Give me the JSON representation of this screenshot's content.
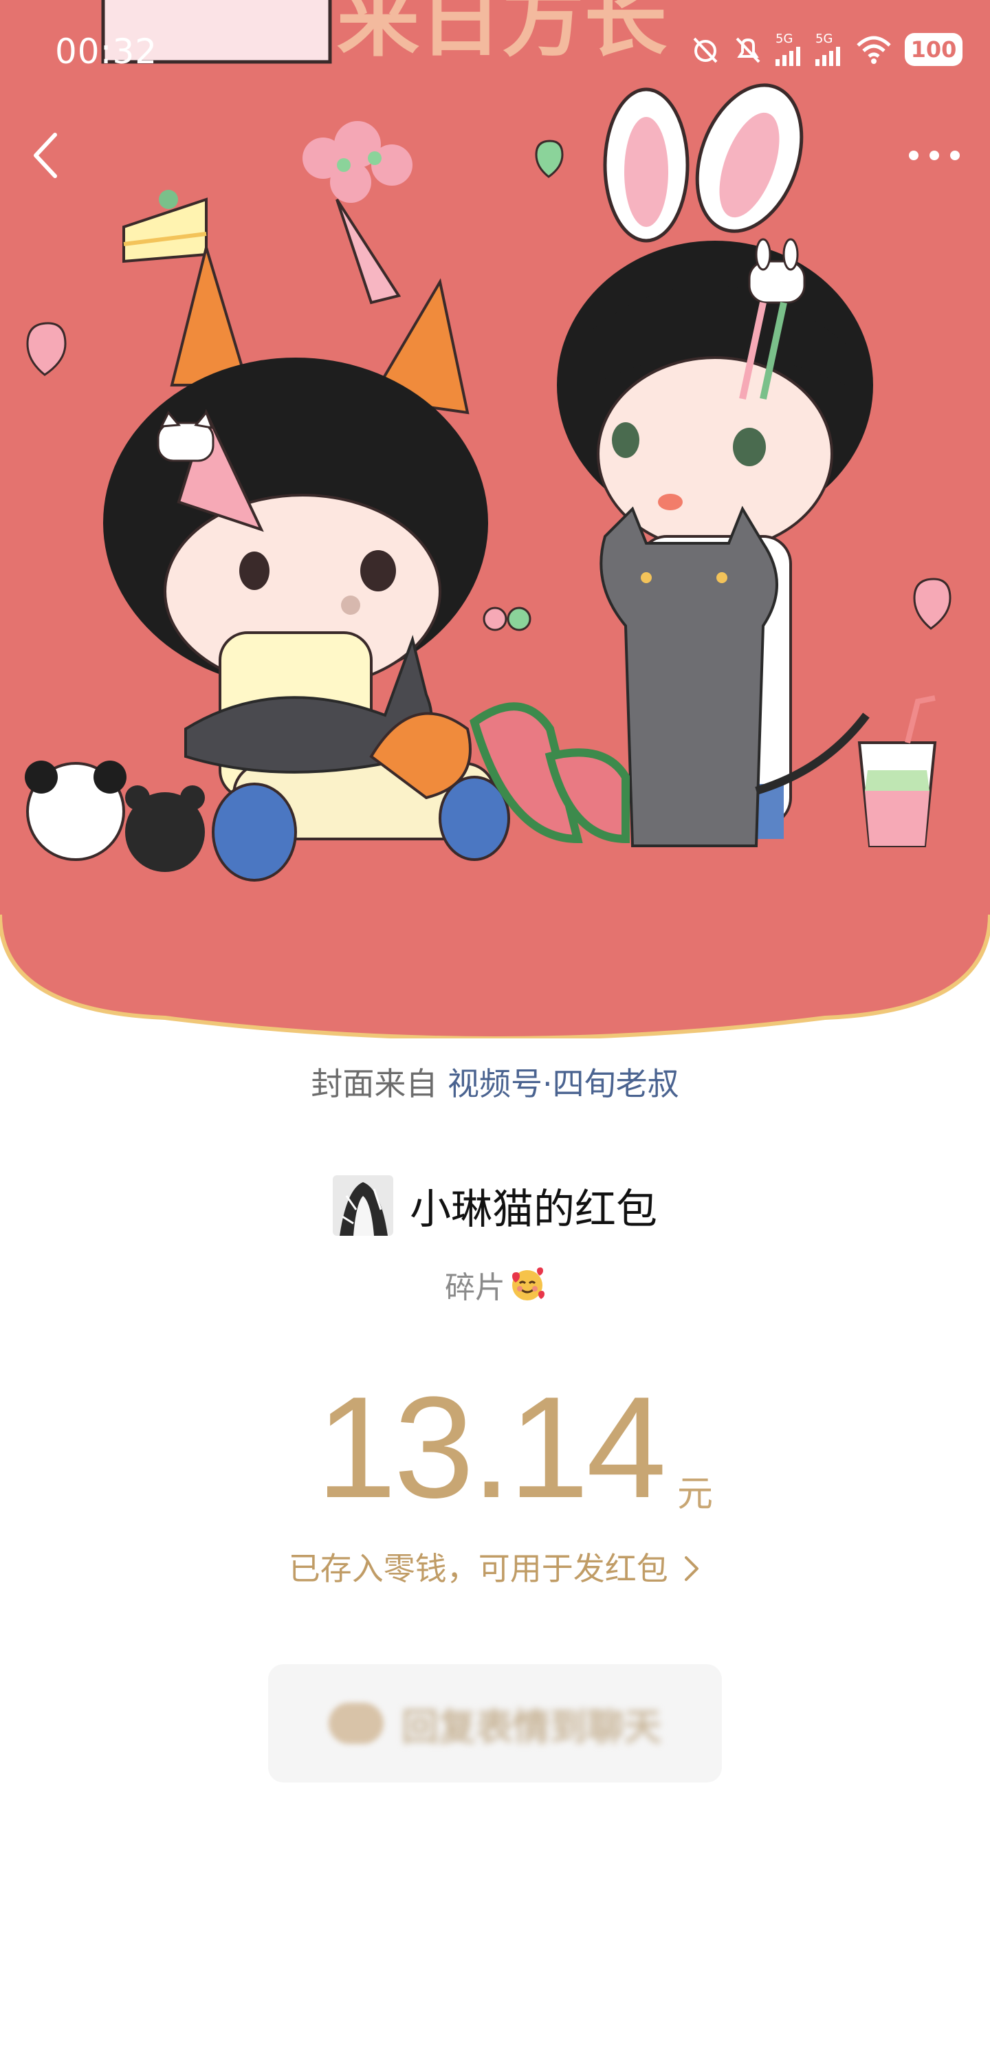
{
  "status_bar": {
    "time": "00:32",
    "network_1": "5G",
    "network_2": "5G",
    "battery": "100"
  },
  "cover": {
    "background_color": "#e4736f",
    "border_color": "#f0c778"
  },
  "source": {
    "prefix": "封面来自",
    "link": "视频号·四旬老叔"
  },
  "sender": {
    "name": "小琳猫的红包"
  },
  "blessing": {
    "text": "碎片",
    "emoji": "smiling-face-with-hearts-icon"
  },
  "amount": {
    "value": "13.14",
    "unit": "元"
  },
  "wallet_link": {
    "text": "已存入零钱，可用于发红包"
  },
  "reply_button": {
    "label": "回复表情到聊天"
  },
  "colors": {
    "accent_gold": "#c8a673",
    "link_blue": "#4a6390"
  }
}
